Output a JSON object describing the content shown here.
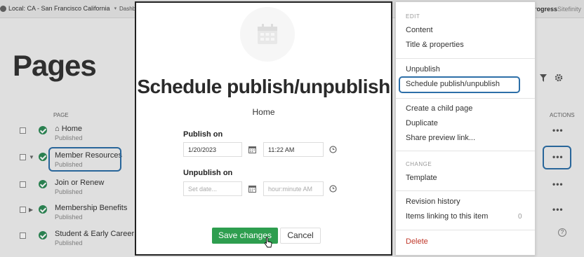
{
  "topbar": {
    "site_label": "Local: CA - San Francisco California",
    "dashboard_link": "Dashb",
    "brand_name": "Progress",
    "brand_product": "Sitefinity"
  },
  "page": {
    "heading": "Pages",
    "col_page": "PAGE",
    "col_actions": "ACTIONS",
    "rows": [
      {
        "title": "Home",
        "status": "Published",
        "icon": "home-icon"
      },
      {
        "title": "Member Resources",
        "status": "Published"
      },
      {
        "title": "Join or Renew",
        "status": "Published"
      },
      {
        "title": "Membership Benefits",
        "status": "Published"
      },
      {
        "title": "Student & Early Career",
        "status": "Published"
      }
    ],
    "actions_glyph": "•••",
    "help_glyph": "?"
  },
  "modal": {
    "title": "Schedule publish/unpublish",
    "subtitle": "Home",
    "publish_label": "Publish on",
    "publish_date": "1/20/2023",
    "publish_time": "11:22 AM",
    "unpublish_label": "Unpublish on",
    "unpublish_date_placeholder": "Set date...",
    "unpublish_time_placeholder": "hour:minute AM",
    "save_label": "Save changes",
    "cancel_label": "Cancel"
  },
  "menu": {
    "edit_section": "EDIT",
    "content": "Content",
    "title_properties": "Title & properties",
    "unpublish": "Unpublish",
    "schedule": "Schedule publish/unpublish",
    "create_child": "Create a child page",
    "duplicate": "Duplicate",
    "share_preview": "Share preview link...",
    "change_section": "CHANGE",
    "template": "Template",
    "revision_history": "Revision history",
    "items_linking": "Items linking to this item",
    "items_linking_count": "0",
    "delete": "Delete"
  },
  "colors": {
    "accent_highlight": "#2d6fa8",
    "save_button": "#2e9e4f",
    "published_status": "#2e8b57",
    "delete_text": "#c0392b"
  }
}
